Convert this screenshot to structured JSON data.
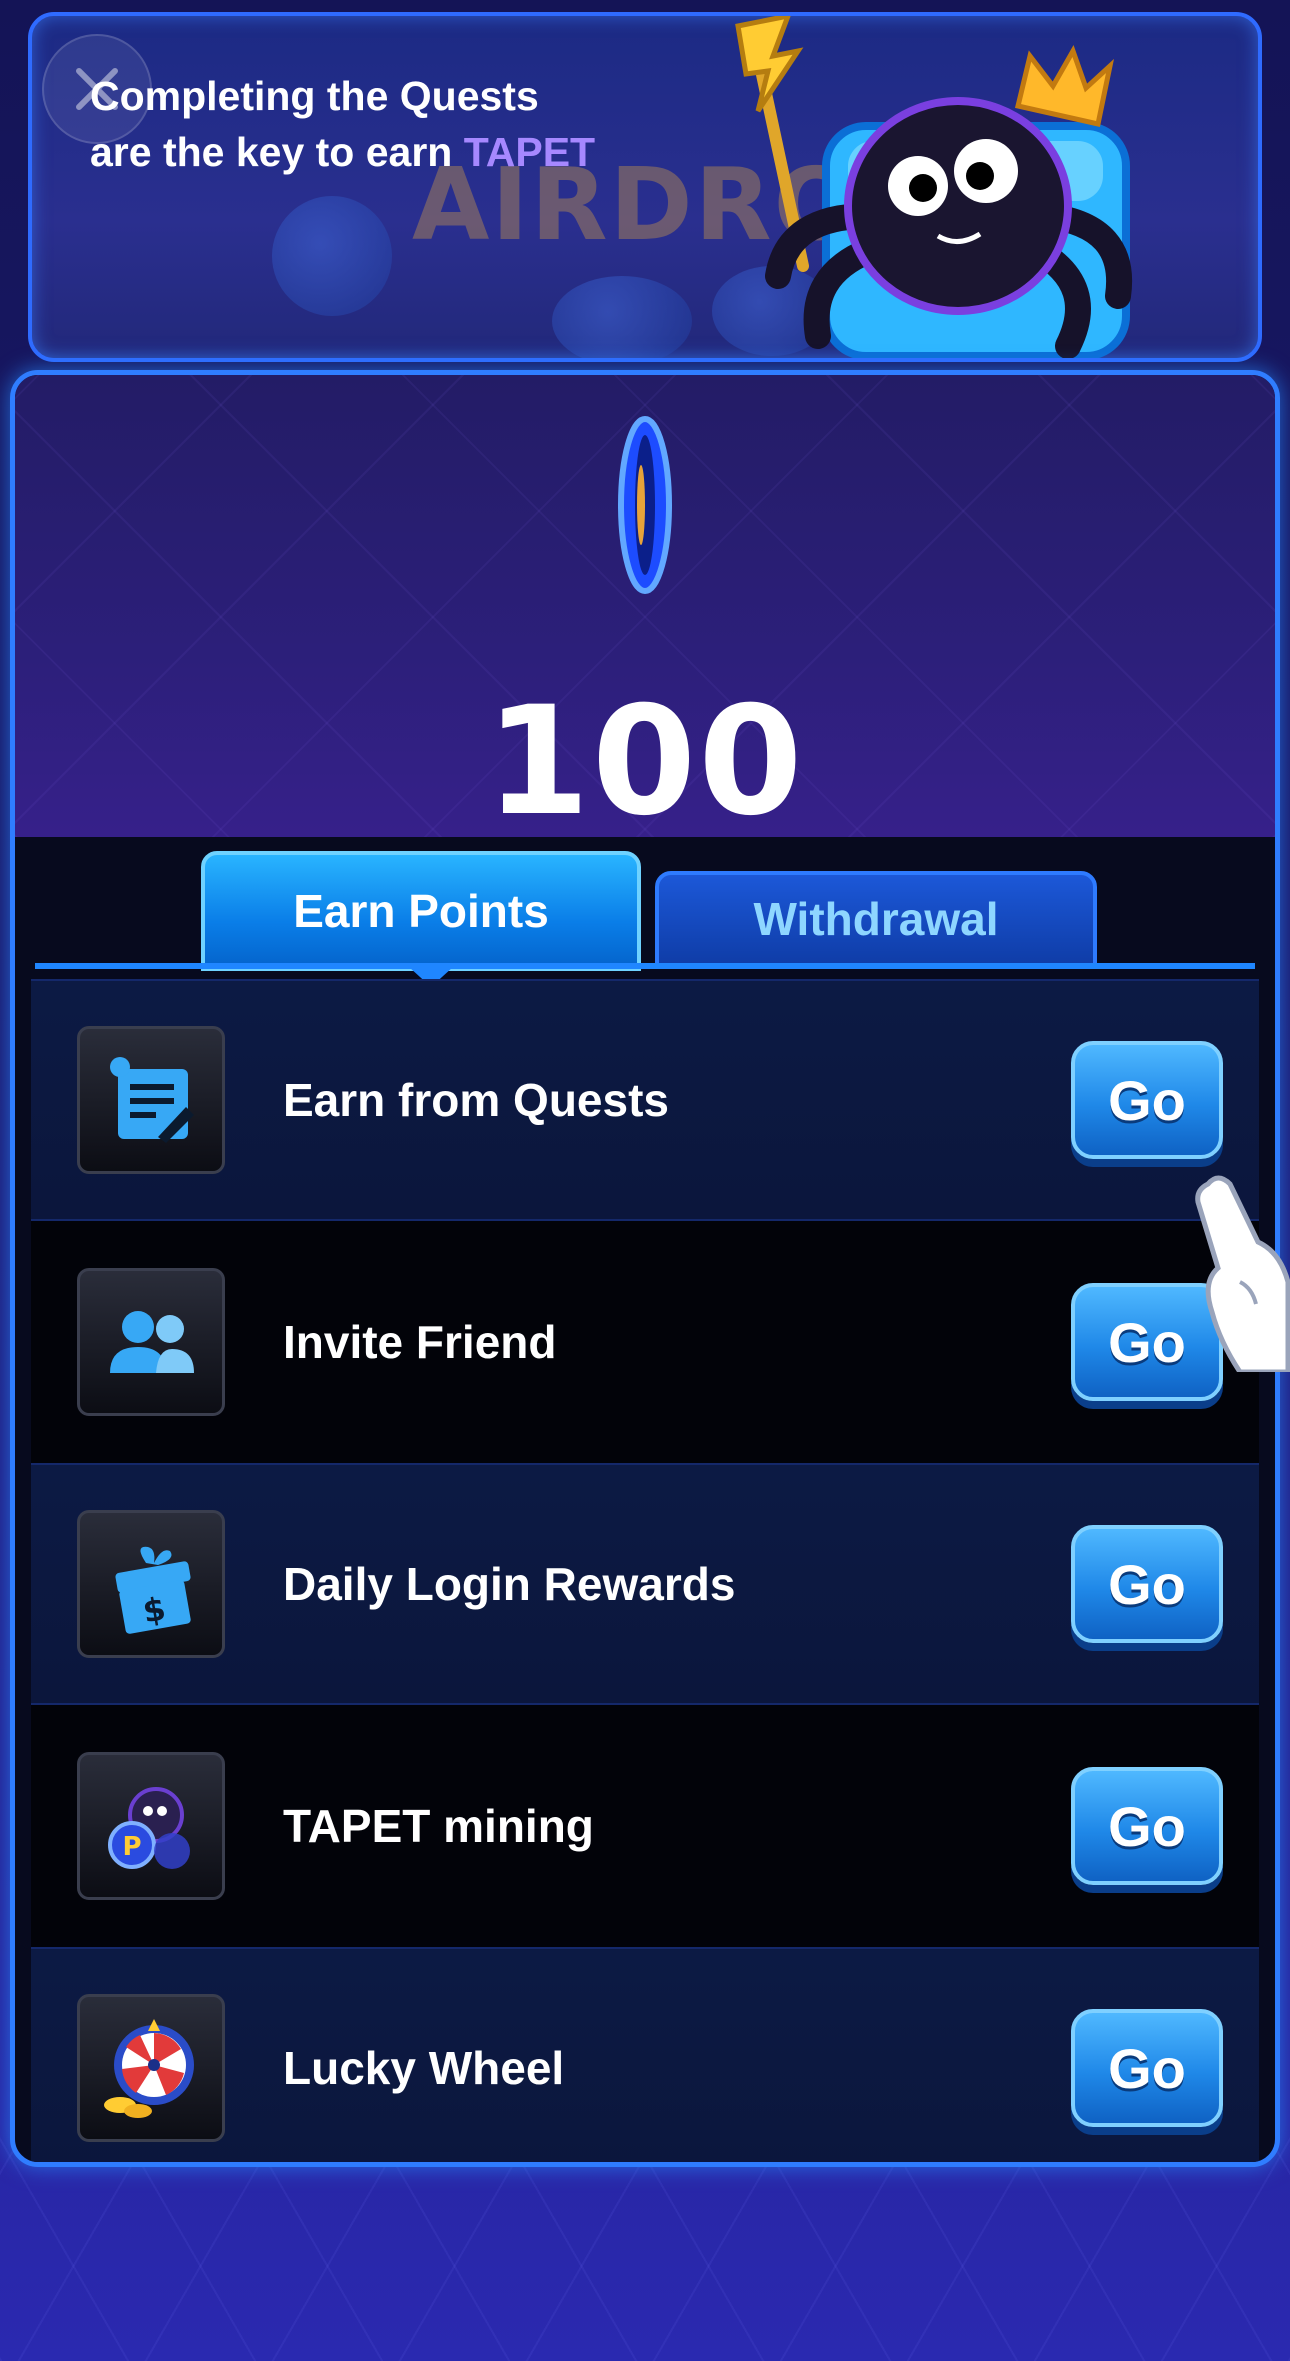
{
  "banner": {
    "line1": "Completing the Quests",
    "line2_prefix": "are the key to earn ",
    "line2_highlight": "TAPET",
    "deco_text": "AIRDRO"
  },
  "score": {
    "value": "100"
  },
  "tabs": [
    {
      "label": "Earn Points",
      "active": true
    },
    {
      "label": "Withdrawal",
      "active": false
    }
  ],
  "quests": [
    {
      "label": "Earn from Quests",
      "icon": "quest-note-icon",
      "button": "Go"
    },
    {
      "label": "Invite Friend",
      "icon": "friends-icon",
      "button": "Go"
    },
    {
      "label": "Daily Login Rewards",
      "icon": "gift-dollar-icon",
      "button": "Go"
    },
    {
      "label": "TAPET mining",
      "icon": "spider-coin-icon",
      "button": "Go"
    },
    {
      "label": "Lucky Wheel",
      "icon": "lucky-wheel-icon",
      "button": "Go"
    }
  ],
  "colors": {
    "accent": "#2f7dff",
    "highlight": "#a688ff",
    "button": "#1f88e8"
  }
}
